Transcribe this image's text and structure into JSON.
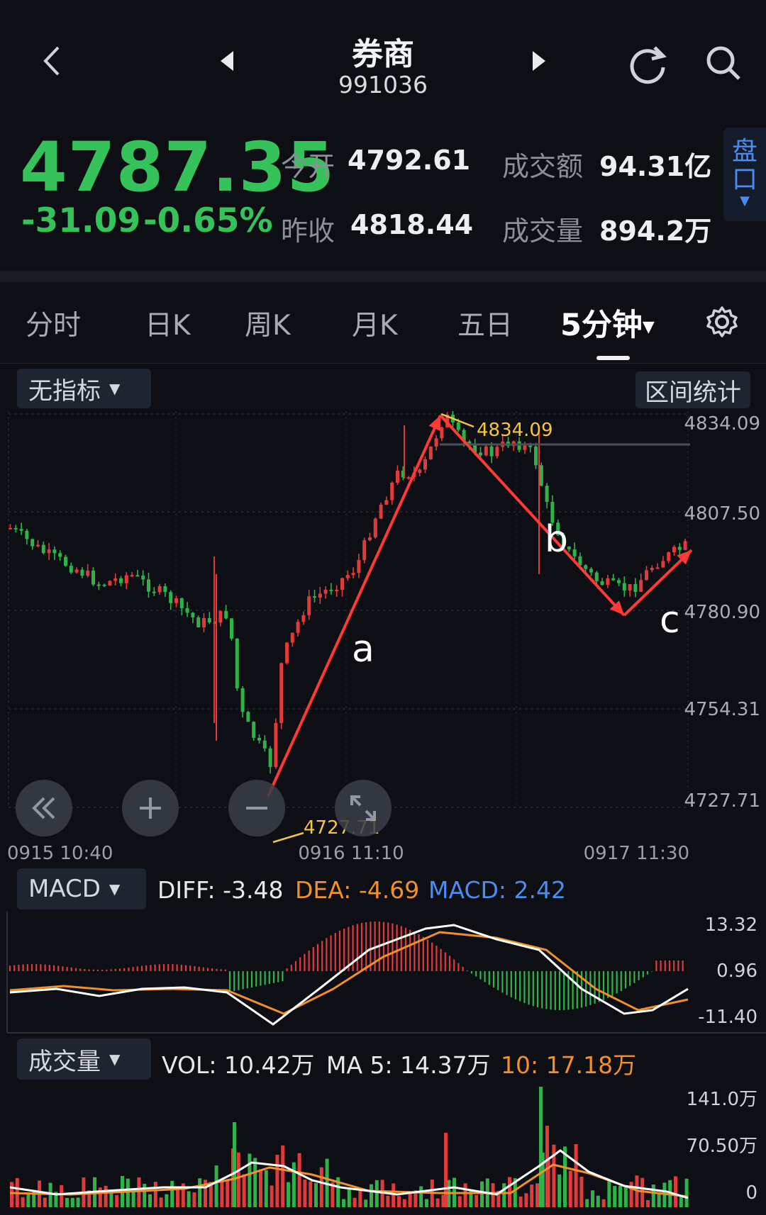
{
  "header": {
    "title": "券商",
    "code": "991036"
  },
  "quote": {
    "price": "4787.35",
    "change": "-31.09",
    "change_pct": "-0.65%",
    "open_label": "今开",
    "open_value": "4792.61",
    "prev_close_label": "昨收",
    "prev_close_value": "4818.44",
    "turnover_label": "成交额",
    "turnover_value": "94.31亿",
    "volume_label": "成交量",
    "volume_value": "894.2万",
    "pankou_label": "盘口"
  },
  "tabs": [
    {
      "label": "分时"
    },
    {
      "label": "日K"
    },
    {
      "label": "周K"
    },
    {
      "label": "月K"
    },
    {
      "label": "五日"
    },
    {
      "label": "5分钟"
    }
  ],
  "active_tab_index": 5,
  "indicator_selector": "无指标",
  "range_stats_button": "区间统计",
  "colors": {
    "up": "#e03b3b",
    "down": "#2fb24a",
    "accent": "#4a8cf0",
    "dea": "#f0902a",
    "annot": "#f5c542",
    "arrow": "#ff3838"
  },
  "chart_data": [
    {
      "type": "candlestick",
      "y_ticks": [
        "4834.09",
        "4807.50",
        "4780.90",
        "4754.31",
        "4727.71"
      ],
      "ylim": [
        4727.71,
        4834.09
      ],
      "x_labels": [
        "0915  10:40",
        "0916  11:10",
        "0917  11:30"
      ],
      "high_marker": "4834.09",
      "low_marker": "4727.71",
      "annotations": [
        "a",
        "b",
        "c"
      ]
    },
    {
      "type": "line",
      "indicator": "MACD",
      "diff_label": "DIFF: -3.48",
      "dea_label": "DEA: -4.69",
      "macd_label": "MACD: 2.42",
      "y_ticks": [
        "13.32",
        "0.96",
        "-11.40"
      ]
    },
    {
      "type": "bar",
      "indicator": "成交量",
      "vol_label": "VOL: 10.42万",
      "ma5_label": "MA 5: 14.37万",
      "ma10_label": "10: 17.18万",
      "y_ticks": [
        "141.0万",
        "70.50万",
        "0"
      ]
    }
  ]
}
